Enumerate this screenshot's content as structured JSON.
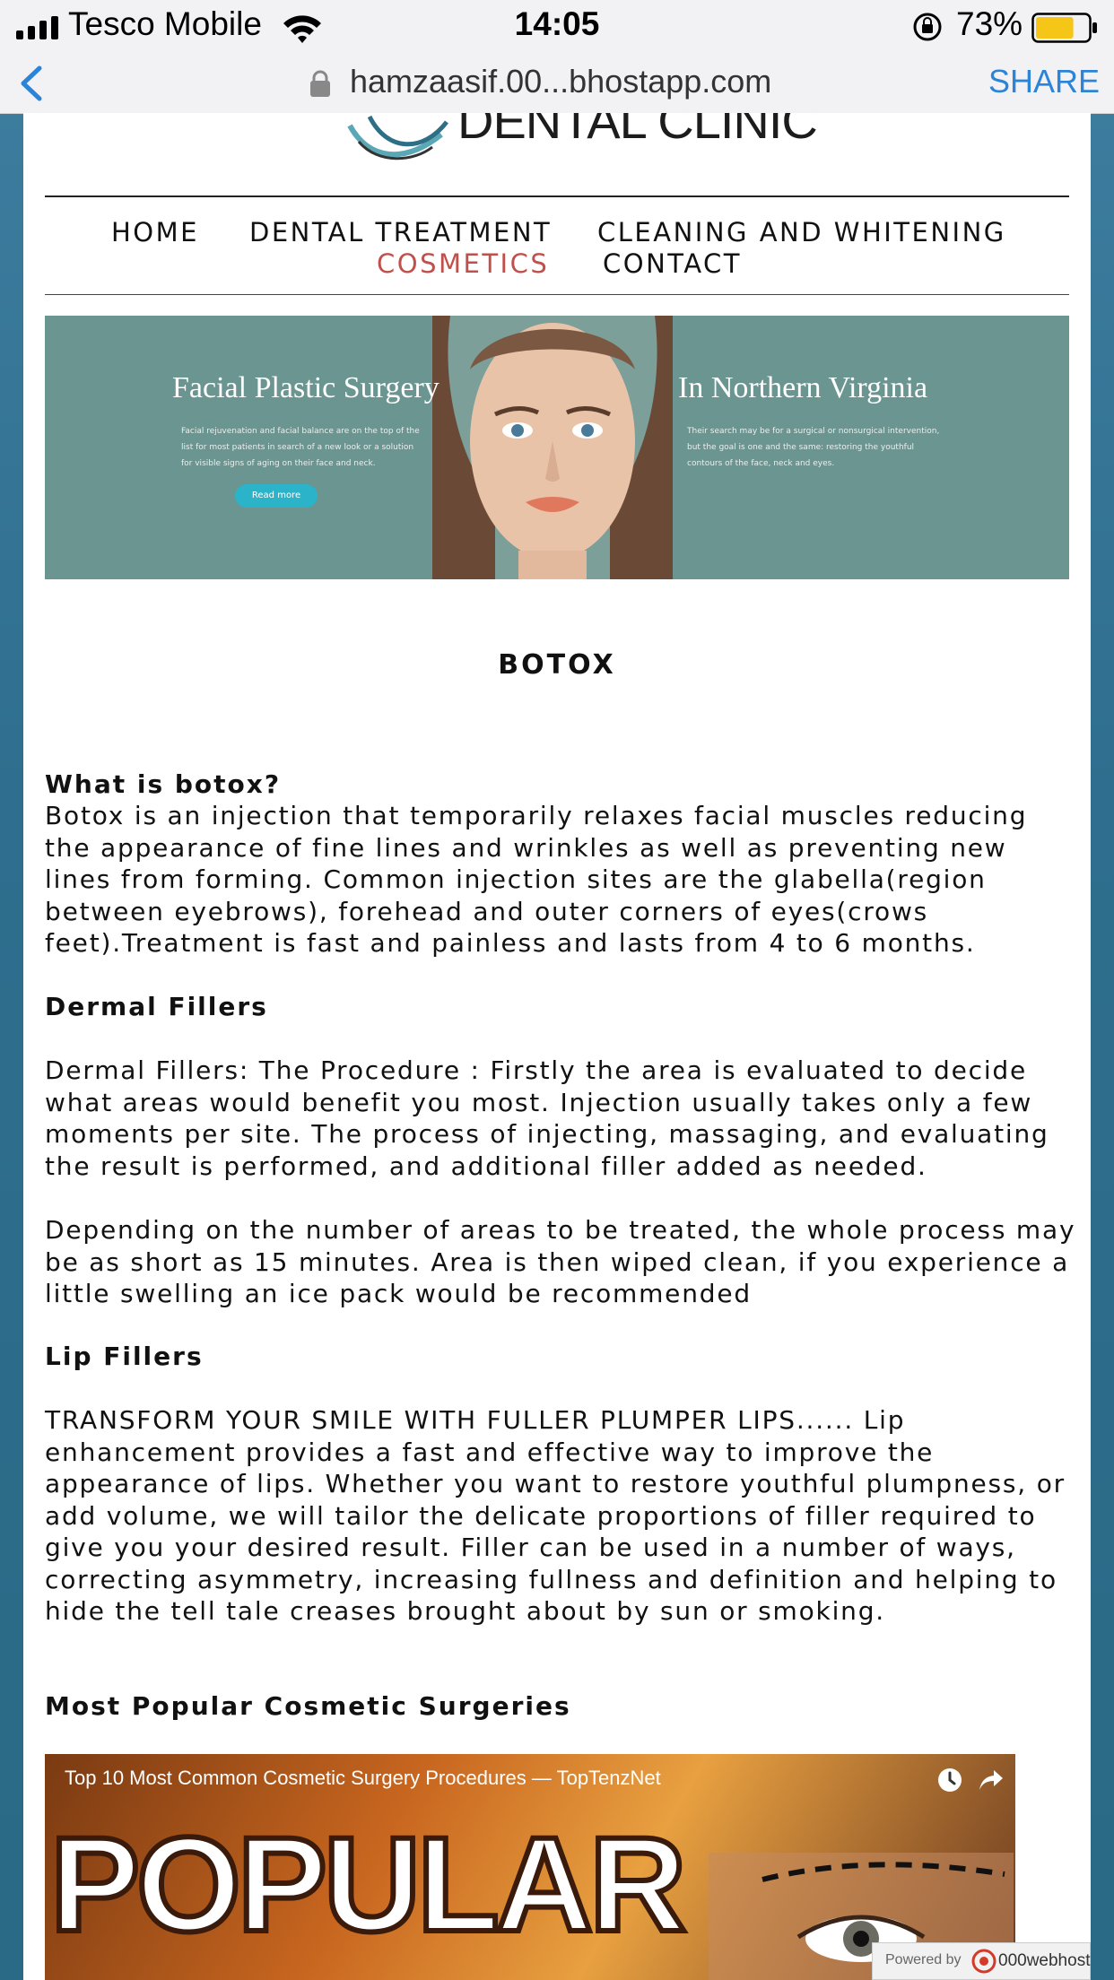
{
  "status_bar": {
    "carrier": "Tesco Mobile",
    "time": "14:05",
    "battery_percent": "73%",
    "battery_level": 0.73,
    "battery_color": "#f5c518"
  },
  "address_bar": {
    "url": "hamzaasif.00...bhostapp.com",
    "share_label": "SHARE"
  },
  "site": {
    "logo_text": "DENTAL CLINIC",
    "nav": [
      {
        "label": "HOME",
        "active": false
      },
      {
        "label": "DENTAL TREATMENT",
        "active": false
      },
      {
        "label": "CLEANING AND WHITENING",
        "active": false
      },
      {
        "label": "COSMETICS",
        "active": true
      },
      {
        "label": "CONTACT",
        "active": false
      }
    ],
    "accent_color": "#c0504b"
  },
  "hero": {
    "title_left": "Facial Plastic Surgery",
    "subtitle_left": "Facial rejuvenation and facial balance are on the top of the list for most patients in search of a new look or a solution for visible signs of aging on their face and neck.",
    "button_label": "Read more",
    "title_right": "In Northern Virginia",
    "subtitle_right": "Their search may be for a surgical or nonsurgical intervention, but the goal is one and the same: restoring the youthful contours of the face, neck and eyes."
  },
  "content": {
    "page_title": "BOTOX",
    "sections": [
      {
        "heading": "What is botox?",
        "body": "Botox is an injection that temporarily relaxes facial muscles reducing the appearance of fine lines and wrinkles as well as preventing new lines from forming. Common injection sites are the glabella(region between eyebrows), forehead and outer corners of eyes(crows feet).Treatment is fast and painless and lasts from 4 to 6 months."
      },
      {
        "heading": "Dermal Fillers",
        "body": "Dermal Fillers: The Procedure : Firstly the area is evaluated to decide what areas would benefit you most. Injection usually takes only a few moments per site. The process of injecting, massaging, and evaluating the result is performed, and additional filler added as needed.",
        "body2": "Depending on the number of areas to be treated, the whole process may be as short as 15 minutes. Area is then wiped clean, if you experience a little swelling an ice pack would be recommended"
      },
      {
        "heading": "Lip Fillers",
        "body": "TRANSFORM YOUR SMILE WITH FULLER PLUMPER LIPS...... Lip enhancement provides a fast and effective way to improve the appearance of lips. Whether you want to restore youthful plumpness, or add volume, we will tailor the delicate proportions of filler required to give you your desired result. Filler can be used in a number of ways, correcting asymmetry, increasing fullness and definition and helping to hide the tell tale creases brought about by sun or smoking."
      },
      {
        "heading": "Most Popular Cosmetic Surgeries"
      }
    ]
  },
  "video": {
    "title": "Top 10 Most Common Cosmetic Surgery Procedures — TopTenzNet",
    "thumbnail_text": "POPULAR"
  },
  "badge": {
    "powered_by": "Powered by",
    "brand": "000webhost"
  }
}
